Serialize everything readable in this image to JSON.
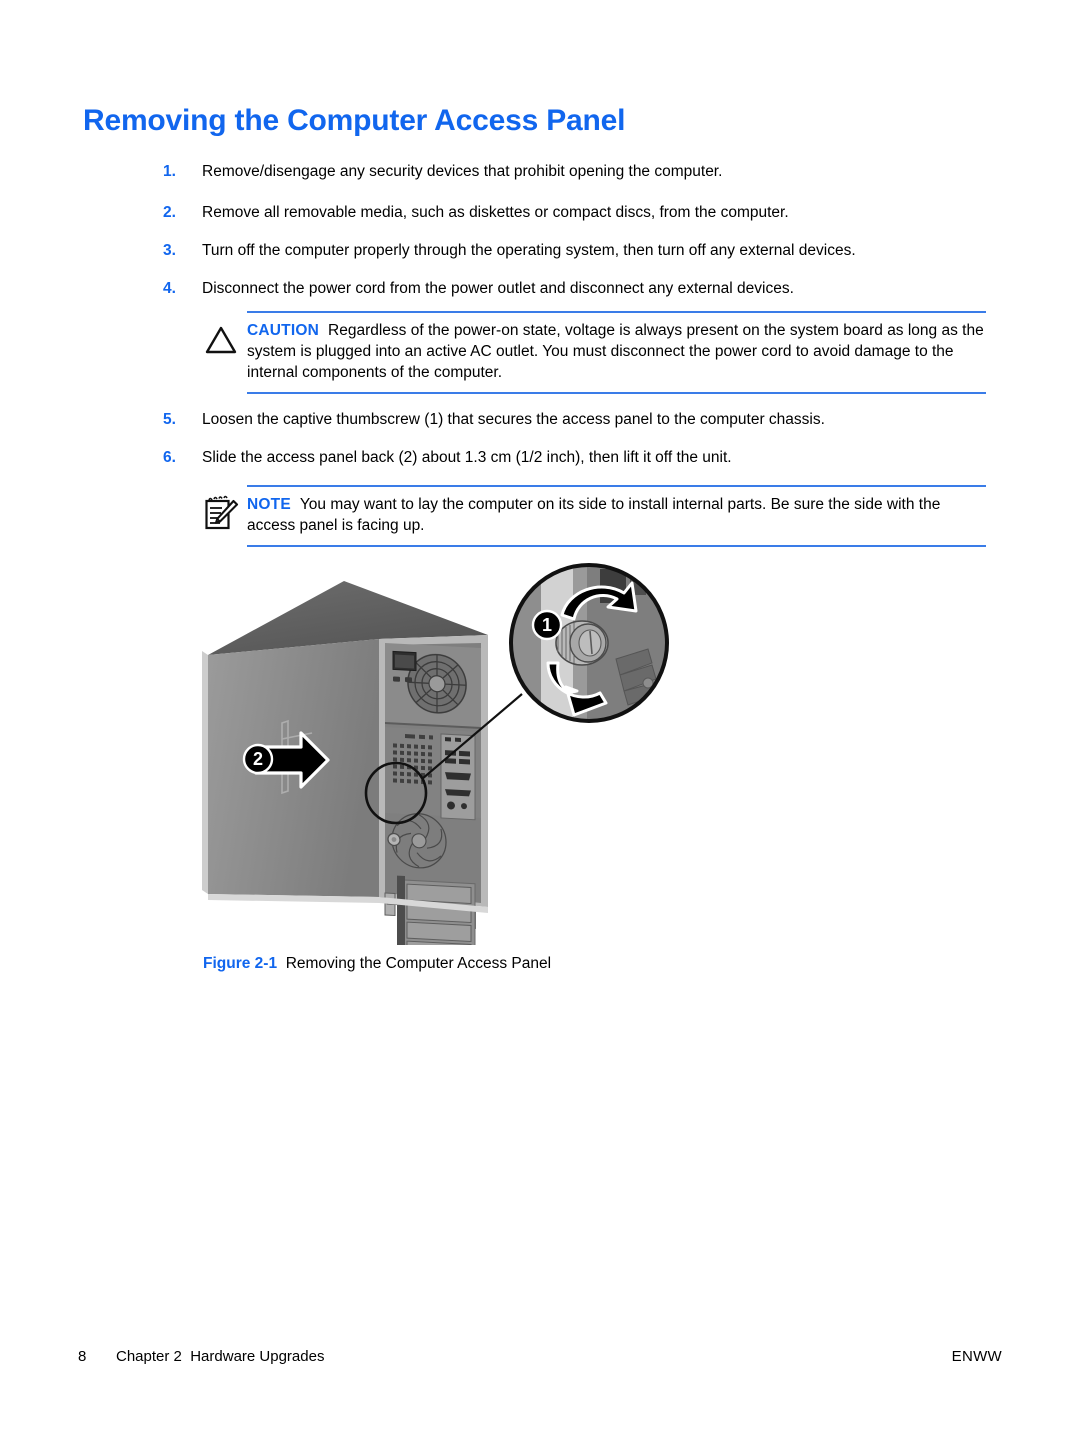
{
  "document": {
    "heading": "Removing the Computer Access Panel"
  },
  "steps": [
    {
      "num": "1.",
      "text": "Remove/disengage any security devices that prohibit opening the computer."
    },
    {
      "num": "2.",
      "text": "Remove all removable media, such as diskettes or compact discs, from the computer."
    },
    {
      "num": "3.",
      "text": "Turn off the computer properly through the operating system, then turn off any external devices."
    },
    {
      "num": "4.",
      "text": "Disconnect the power cord from the power outlet and disconnect any external devices."
    },
    {
      "num": "5.",
      "text": "Loosen the captive thumbscrew (1) that secures the access panel to the computer chassis."
    },
    {
      "num": "6.",
      "text": "Slide the access panel back (2) about 1.3 cm (1/2 inch), then lift it off the unit."
    }
  ],
  "caution": {
    "icon": "warning-triangle-icon",
    "label": "CAUTION",
    "text": "Regardless of the power-on state, voltage is always present on the system board as long as the system is plugged into an active AC outlet. You must disconnect the power cord to avoid damage to the internal components of the computer."
  },
  "note": {
    "icon": "notepad-pencil-icon",
    "label": "NOTE",
    "text": "You may want to lay the computer on its side to install internal parts. Be sure the side with the access panel is facing up."
  },
  "figure": {
    "number": "Figure 2-1",
    "caption": "Removing the Computer Access Panel",
    "alt": "Grayscale illustration of a tower computer viewed from the rear-left with callout 1 on a magnified thumbscrew inset and callout 2 on the side access panel",
    "callouts": [
      {
        "id": "1",
        "target": "captive-thumbscrew"
      },
      {
        "id": "2",
        "target": "access-panel-slide"
      }
    ]
  },
  "footer": {
    "page_number": "8",
    "chapter": "Chapter 2",
    "chapter_title": "Hardware Upgrades",
    "locale": "ENWW"
  },
  "colors": {
    "accent_blue": "#1166ee",
    "rule_blue": "#3a7ce8",
    "text_black": "#000000",
    "page_background": "#ffffff"
  }
}
